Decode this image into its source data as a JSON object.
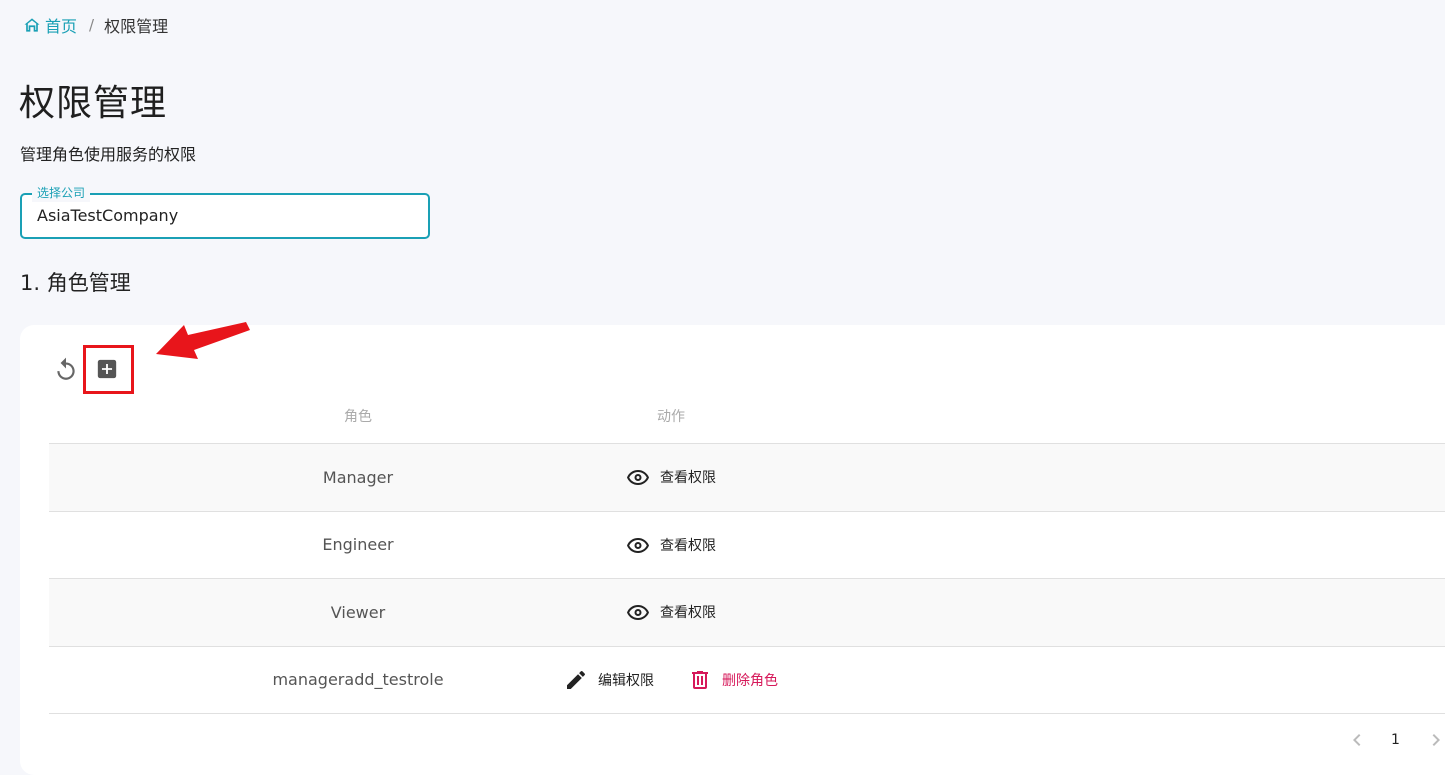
{
  "breadcrumb": {
    "home_label": "首页",
    "separator": "/",
    "current": "权限管理"
  },
  "page": {
    "title": "权限管理",
    "description": "管理角色使用服务的权限"
  },
  "company_select": {
    "label": "选择公司",
    "value": "AsiaTestCompany"
  },
  "section": {
    "title": "1. 角色管理"
  },
  "toolbar": {
    "refresh_icon": "refresh-icon",
    "add_icon": "add-box-icon"
  },
  "table": {
    "headers": {
      "role": "角色",
      "action": "动作"
    },
    "rows": [
      {
        "role": "Manager",
        "actions": [
          {
            "icon": "eye-icon",
            "label": "查看权限"
          }
        ]
      },
      {
        "role": "Engineer",
        "actions": [
          {
            "icon": "eye-icon",
            "label": "查看权限"
          }
        ]
      },
      {
        "role": "Viewer",
        "actions": [
          {
            "icon": "eye-icon",
            "label": "查看权限"
          }
        ]
      },
      {
        "role": "manageradd_testrole",
        "actions": [
          {
            "icon": "pencil-icon",
            "label": "编辑权限"
          },
          {
            "icon": "trash-icon",
            "label": "删除角色"
          }
        ]
      }
    ]
  },
  "pagination": {
    "current_page": "1"
  },
  "colors": {
    "accent": "#1aa0b5",
    "danger": "#d6195a",
    "annotation": "#e8151b"
  }
}
